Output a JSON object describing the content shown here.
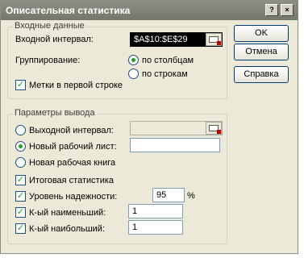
{
  "window": {
    "title": "Описательная статистика",
    "help_glyph": "?",
    "close_glyph": "×"
  },
  "input_group": {
    "title": "Входные данные",
    "input_range_label": "Входной интервал:",
    "input_range_value": "$A$10:$E$29",
    "grouping_label": "Группирование:",
    "by_columns": "по столбцам",
    "by_rows": "по строкам",
    "grouping_selected": "по столбцам",
    "labels_first_row": "Метки в первой строке",
    "labels_first_row_checked": true
  },
  "output_group": {
    "title": "Параметры вывода",
    "output_range_label": "Выходной интервал:",
    "output_range_value": "",
    "new_sheet_label": "Новый рабочий лист:",
    "new_sheet_value": "",
    "new_workbook_label": "Новая рабочая книга",
    "output_selected": "Новый рабочий лист:",
    "summary_stats_label": "Итоговая статистика",
    "summary_stats_checked": true,
    "confidence_label": "Уровень надежности:",
    "confidence_checked": true,
    "confidence_value": "95",
    "confidence_unit": "%",
    "kth_smallest_label": "К-ый наименьший:",
    "kth_smallest_checked": true,
    "kth_smallest_value": "1",
    "kth_largest_label": "К-ый наибольший:",
    "kth_largest_checked": true,
    "kth_largest_value": "1"
  },
  "buttons": {
    "ok": "OK",
    "cancel": "Отмена",
    "help": "Справка"
  },
  "check_glyph": "✓"
}
